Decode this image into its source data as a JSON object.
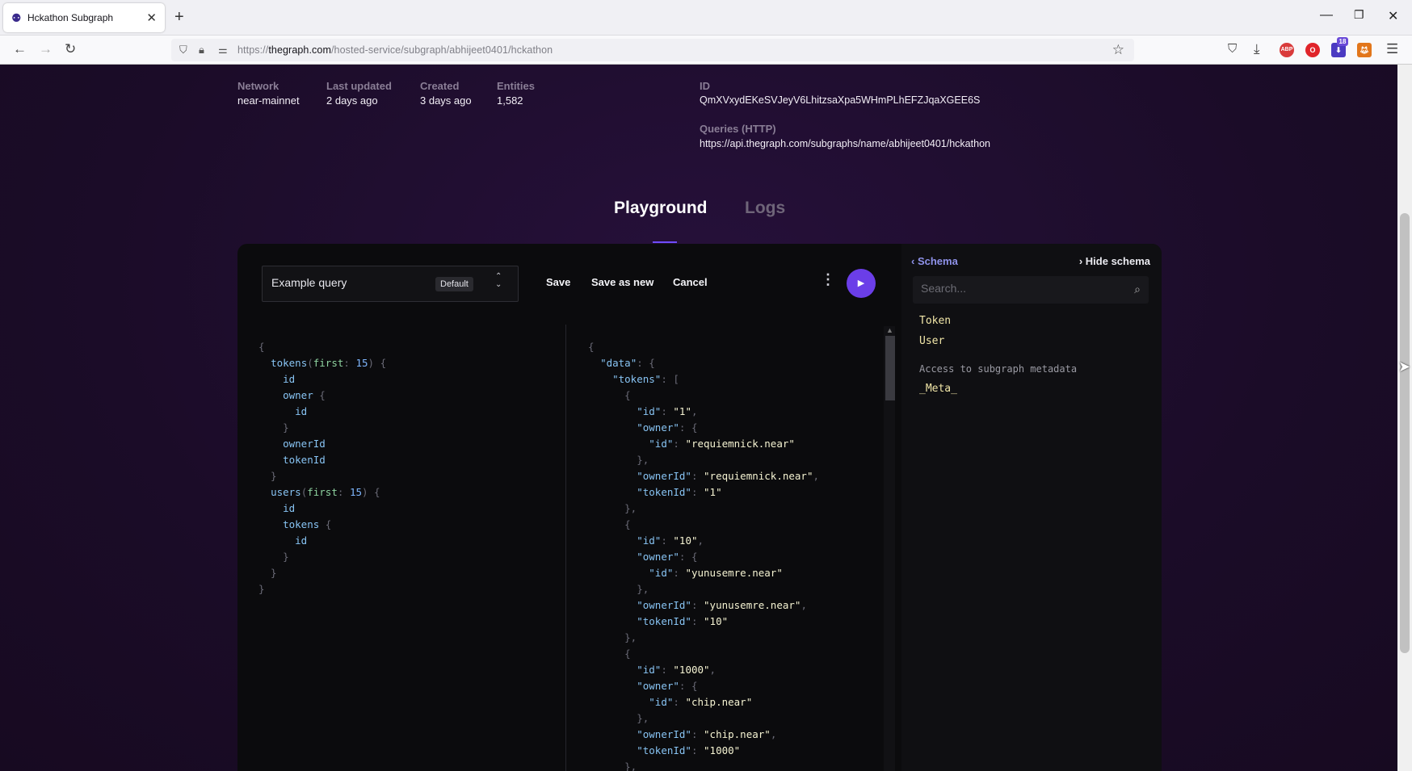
{
  "browser": {
    "tab_title": "Hckathon Subgraph",
    "new_tab_icon": "plus-icon",
    "url_prefix": "https://",
    "url_domain": "thegraph.com",
    "url_path": "/hosted-service/subgraph/abhijeet0401/hckathon",
    "extension_badge": "18",
    "abp_label": "ABP"
  },
  "meta": {
    "network_label": "Network",
    "network_value": "near-mainnet",
    "updated_label": "Last updated",
    "updated_value": "2 days ago",
    "created_label": "Created",
    "created_value": "3 days ago",
    "entities_label": "Entities",
    "entities_value": "1,582",
    "id_label": "ID",
    "id_value": "QmXVxydEKeSVJeyV6LhitzsaXpa5WHmPLhEFZJqaXGEE6S",
    "queries_label": "Queries (HTTP)",
    "queries_value": "https://api.thegraph.com/subgraphs/name/abhijeet0401/hckathon"
  },
  "tabs": {
    "playground": "Playground",
    "logs": "Logs"
  },
  "toolbar": {
    "query_name": "Example query",
    "default_badge": "Default",
    "save": "Save",
    "save_as_new": "Save as new",
    "cancel": "Cancel",
    "more": "⋮",
    "run": "▶"
  },
  "query_lines": [
    "{",
    "  tokens(first: 15) {",
    "    id",
    "    owner {",
    "      id",
    "    }",
    "    ownerId",
    "    tokenId",
    "  }",
    "  users(first: 15) {",
    "    id",
    "    tokens {",
    "      id",
    "    }",
    "  }",
    "}"
  ],
  "result_lines": [
    "{",
    "  \"data\": {",
    "    \"tokens\": [",
    "      {",
    "        \"id\": \"1\",",
    "        \"owner\": {",
    "          \"id\": \"requiemnick.near\"",
    "        },",
    "        \"ownerId\": \"requiemnick.near\",",
    "        \"tokenId\": \"1\"",
    "      },",
    "      {",
    "        \"id\": \"10\",",
    "        \"owner\": {",
    "          \"id\": \"yunusemre.near\"",
    "        },",
    "        \"ownerId\": \"yunusemre.near\",",
    "        \"tokenId\": \"10\"",
    "      },",
    "      {",
    "        \"id\": \"1000\",",
    "        \"owner\": {",
    "          \"id\": \"chip.near\"",
    "        },",
    "        \"ownerId\": \"chip.near\",",
    "        \"tokenId\": \"1000\"",
    "      },"
  ],
  "schema": {
    "back_label": "Schema",
    "hide_label": "Hide schema",
    "search_placeholder": "Search...",
    "types": [
      "Token",
      "User"
    ],
    "note": "Access to subgraph metadata",
    "meta_type": "_Meta_"
  }
}
